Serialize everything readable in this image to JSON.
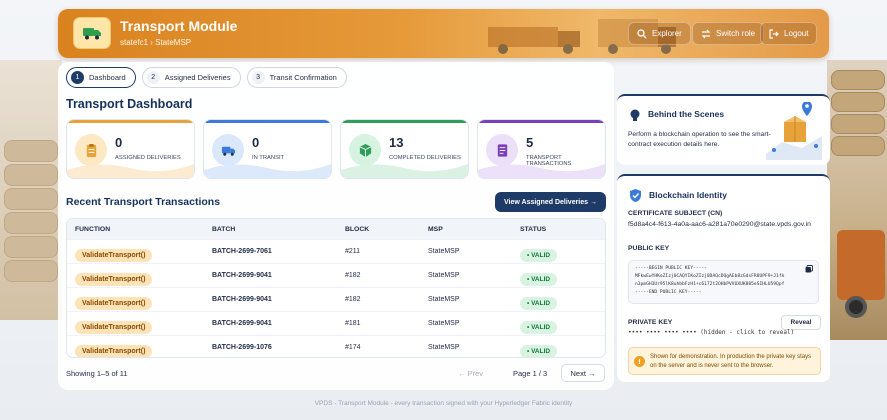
{
  "header": {
    "title": "Transport Module",
    "breadcrumb": "statefc1 › StateMSP",
    "buttons": {
      "explorer": "Explorer",
      "switch_role": "Switch role",
      "logout": "Logout"
    }
  },
  "steps": [
    {
      "num": "1",
      "label": "Dashboard",
      "active": true
    },
    {
      "num": "2",
      "label": "Assigned Deliveries",
      "active": false
    },
    {
      "num": "3",
      "label": "Transit Confirmation",
      "active": false
    }
  ],
  "dashboard": {
    "title": "Transport Dashboard",
    "cards": [
      {
        "value": "0",
        "label": "Assigned Deliveries",
        "accent": "#e8a23a",
        "icon": "clipboard-icon"
      },
      {
        "value": "0",
        "label": "In Transit",
        "accent": "#3b7bd8",
        "icon": "truck-icon"
      },
      {
        "value": "13",
        "label": "Completed Deliveries",
        "accent": "#2f9e5a",
        "icon": "box-icon"
      },
      {
        "value": "5",
        "label": "Transport Transactions",
        "accent": "#7b3fb8",
        "icon": "document-icon"
      }
    ]
  },
  "recent": {
    "title": "Recent Transport Transactions",
    "view_button": "View Assigned Deliveries →",
    "columns": [
      "FUNCTION",
      "BATCH",
      "BLOCK",
      "MSP",
      "STATUS"
    ],
    "rows": [
      {
        "function": "ValidateTransport()",
        "batch": "BATCH-2699-7061",
        "block": "#211",
        "msp": "StateMSP",
        "status": "• VALID"
      },
      {
        "function": "ValidateTransport()",
        "batch": "BATCH-2699-9041",
        "block": "#182",
        "msp": "StateMSP",
        "status": "• VALID"
      },
      {
        "function": "ValidateTransport()",
        "batch": "BATCH-2699-9041",
        "block": "#182",
        "msp": "StateMSP",
        "status": "• VALID"
      },
      {
        "function": "ValidateTransport()",
        "batch": "BATCH-2699-9041",
        "block": "#181",
        "msp": "StateMSP",
        "status": "• VALID"
      },
      {
        "function": "ValidateTransport()",
        "batch": "BATCH-2699-1076",
        "block": "#174",
        "msp": "StateMSP",
        "status": "• VALID"
      }
    ],
    "showing": "Showing 1–5 of 11",
    "prev": "← Prev",
    "page": "Page 1 / 3",
    "next": "Next →"
  },
  "scenes": {
    "title": "Behind the Scenes",
    "description": "Perform a blockchain operation to see the smart-contract execution details here."
  },
  "identity": {
    "title": "Blockchain Identity",
    "cert_label": "CERTIFICATE SUBJECT (CN)",
    "cert_value": "f5d8a4c4-f613-4a0a-aac6-a281a70e0290@state.vpds.gov.in",
    "public_key_label": "PUBLIC KEY",
    "public_key_lines": [
      "-----BEGIN PUBLIC KEY-----",
      "MFkwEwYHKoZIzj0CAQYIKoZIzj0DAQcDQgAEb8zGdsFR8UPF9+J1fk",
      "n3pmGH3Ur95lK8uhbbFzH1+c6172t2OHbPVVUXUK885eSIHLU59Qpf",
      "-----END PUBLIC KEY-----"
    ],
    "private_key_label": "PRIVATE KEY",
    "reveal_button": "Reveal",
    "private_masked": "•••• •••• •••• ••••  (hidden - click to reveal)",
    "warning": "Shown for demonstration. In production the private key stays on the server and is never sent to the browser."
  },
  "footer": "VPDS - Transport Module - every transaction signed with your Hyperledger Fabric identity"
}
